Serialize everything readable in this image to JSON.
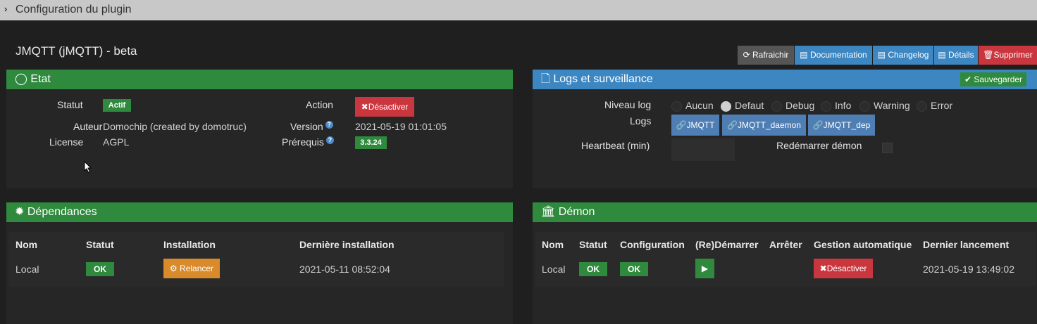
{
  "topbar": {
    "title": "Configuration du plugin"
  },
  "plugin_title": "JMQTT (jMQTT) - beta",
  "toolbar": {
    "refresh": "Rafraichir",
    "documentation": "Documentation",
    "changelog": "Changelog",
    "details": "Détails",
    "delete": "Supprimer"
  },
  "etat": {
    "title": "Etat",
    "statut_label": "Statut",
    "statut_value": "Actif",
    "action_label": "Action",
    "action_button": "Désactiver",
    "auteur_label": "Auteur",
    "auteur_value": "Domochip (created by domotruc)",
    "version_label": "Version",
    "version_value": "2021-05-19 01:01:05",
    "license_label": "License",
    "license_value": "AGPL",
    "prerequis_label": "Prérequis",
    "prerequis_value": "3.3.24"
  },
  "logs": {
    "title": "Logs et surveillance",
    "save_button": "Sauvegarder",
    "niveau_label": "Niveau log",
    "levels": [
      "Aucun",
      "Defaut",
      "Debug",
      "Info",
      "Warning",
      "Error"
    ],
    "selected_level": "Defaut",
    "logs_label": "Logs",
    "log_buttons": [
      "JMQTT",
      "JMQTT_daemon",
      "JMQTT_dep"
    ],
    "heartbeat_label": "Heartbeat (min)",
    "heartbeat_value": "",
    "restart_label": "Redémarrer démon"
  },
  "dependances": {
    "title": "Dépendances",
    "headers": [
      "Nom",
      "Statut",
      "Installation",
      "Dernière installation"
    ],
    "row": {
      "nom": "Local",
      "statut": "OK",
      "installation": "Relancer",
      "derniere": "2021-05-11 08:52:04"
    }
  },
  "demon": {
    "title": "Démon",
    "headers": [
      "Nom",
      "Statut",
      "Configuration",
      "(Re)Démarrer",
      "Arrêter",
      "Gestion automatique",
      "Dernier lancement"
    ],
    "row": {
      "nom": "Local",
      "statut": "OK",
      "configuration": "OK",
      "gestion": "Désactiver",
      "dernier": "2021-05-19 13:49:02"
    }
  },
  "colors": {
    "green": "#2f8a3e",
    "blue": "#3c86c2",
    "red": "#c9363d",
    "orange": "#d98a2a",
    "log_button": "#4f7eb4"
  }
}
